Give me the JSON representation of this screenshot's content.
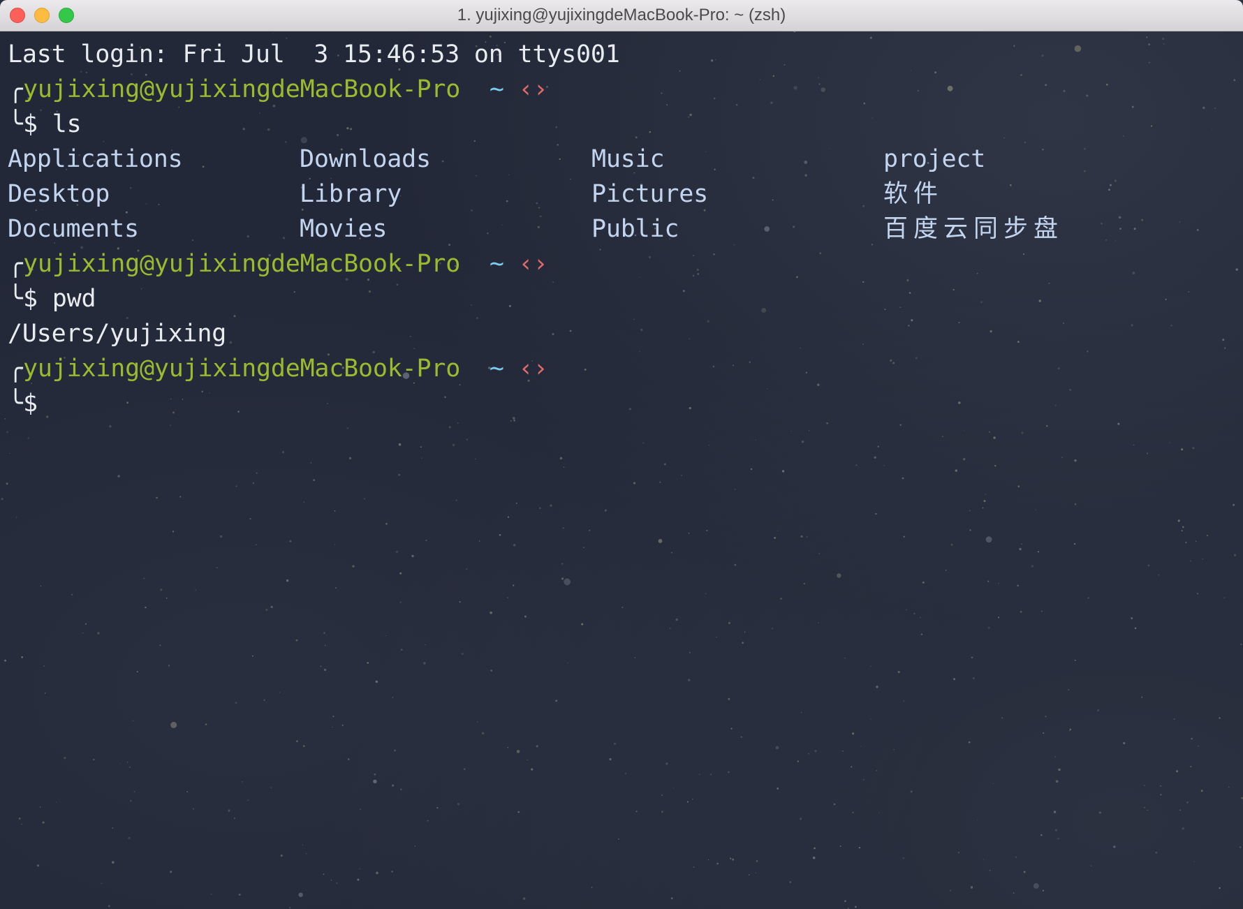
{
  "window": {
    "title": "1. yujixing@yujixingdeMacBook-Pro: ~ (zsh)",
    "buttons": [
      "close",
      "minimize",
      "zoom"
    ]
  },
  "colors": {
    "background": "#232838",
    "prompt_user_host": "#9bbb2f",
    "prompt_tilde": "#7ccbf0",
    "prompt_git_arrows": "#e06a6a",
    "output_text": "#e8ecef",
    "directory_text": "#c3d5ee"
  },
  "terminal": {
    "last_login": "Last login: Fri Jul  3 15:46:53 on ttys001",
    "prompt": {
      "top_corner": "╭",
      "bottom_corner": "╰",
      "user_host": "yujixing@yujixingdeMacBook-Pro",
      "cwd": "~",
      "git_indicator": "‹›",
      "symbol": "$"
    },
    "commands": [
      {
        "command": "ls"
      },
      {
        "command": "pwd",
        "output": "/Users/yujixing"
      },
      {
        "command": ""
      }
    ],
    "ls_output": {
      "rows": [
        [
          "Applications",
          "Downloads",
          "Music",
          "project"
        ],
        [
          "Desktop",
          "Library",
          "Pictures",
          "软件"
        ],
        [
          "Documents",
          "Movies",
          "Public",
          "百度云同步盘"
        ]
      ]
    }
  }
}
